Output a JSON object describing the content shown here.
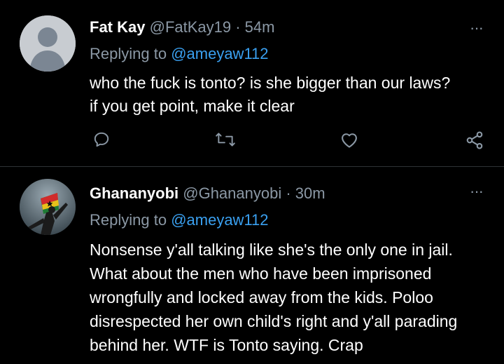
{
  "tweets": [
    {
      "name": "Fat Kay",
      "handle": "@FatKay19",
      "sep": " · ",
      "time": "54m",
      "replying_prefix": "Replying to ",
      "replying_to": "@ameyaw112",
      "text_lines": [
        "who the fuck is tonto? is she bigger than our laws?",
        "if you get point, make it clear"
      ],
      "more": "···"
    },
    {
      "name": "Ghananyobi",
      "handle": "@Ghananyobi",
      "sep": " · ",
      "time": "30m",
      "replying_prefix": "Replying to ",
      "replying_to": "@ameyaw112",
      "text_lines": [
        "Nonsense y'all talking like she's the only one in jail.",
        "What about the men who have been imprisoned",
        "wrongfully and locked away from the kids. Poloo",
        "disrespected her own child's right and y'all parading",
        "behind her. WTF is Tonto saying. Crap"
      ],
      "more": "···"
    }
  ],
  "icons": [
    "reply-icon",
    "retweet-icon",
    "like-icon",
    "share-icon"
  ],
  "colors": {
    "background": "#000000",
    "muted": "#8b98a5",
    "link": "#3aa0f0",
    "divider": "#2f3336"
  }
}
